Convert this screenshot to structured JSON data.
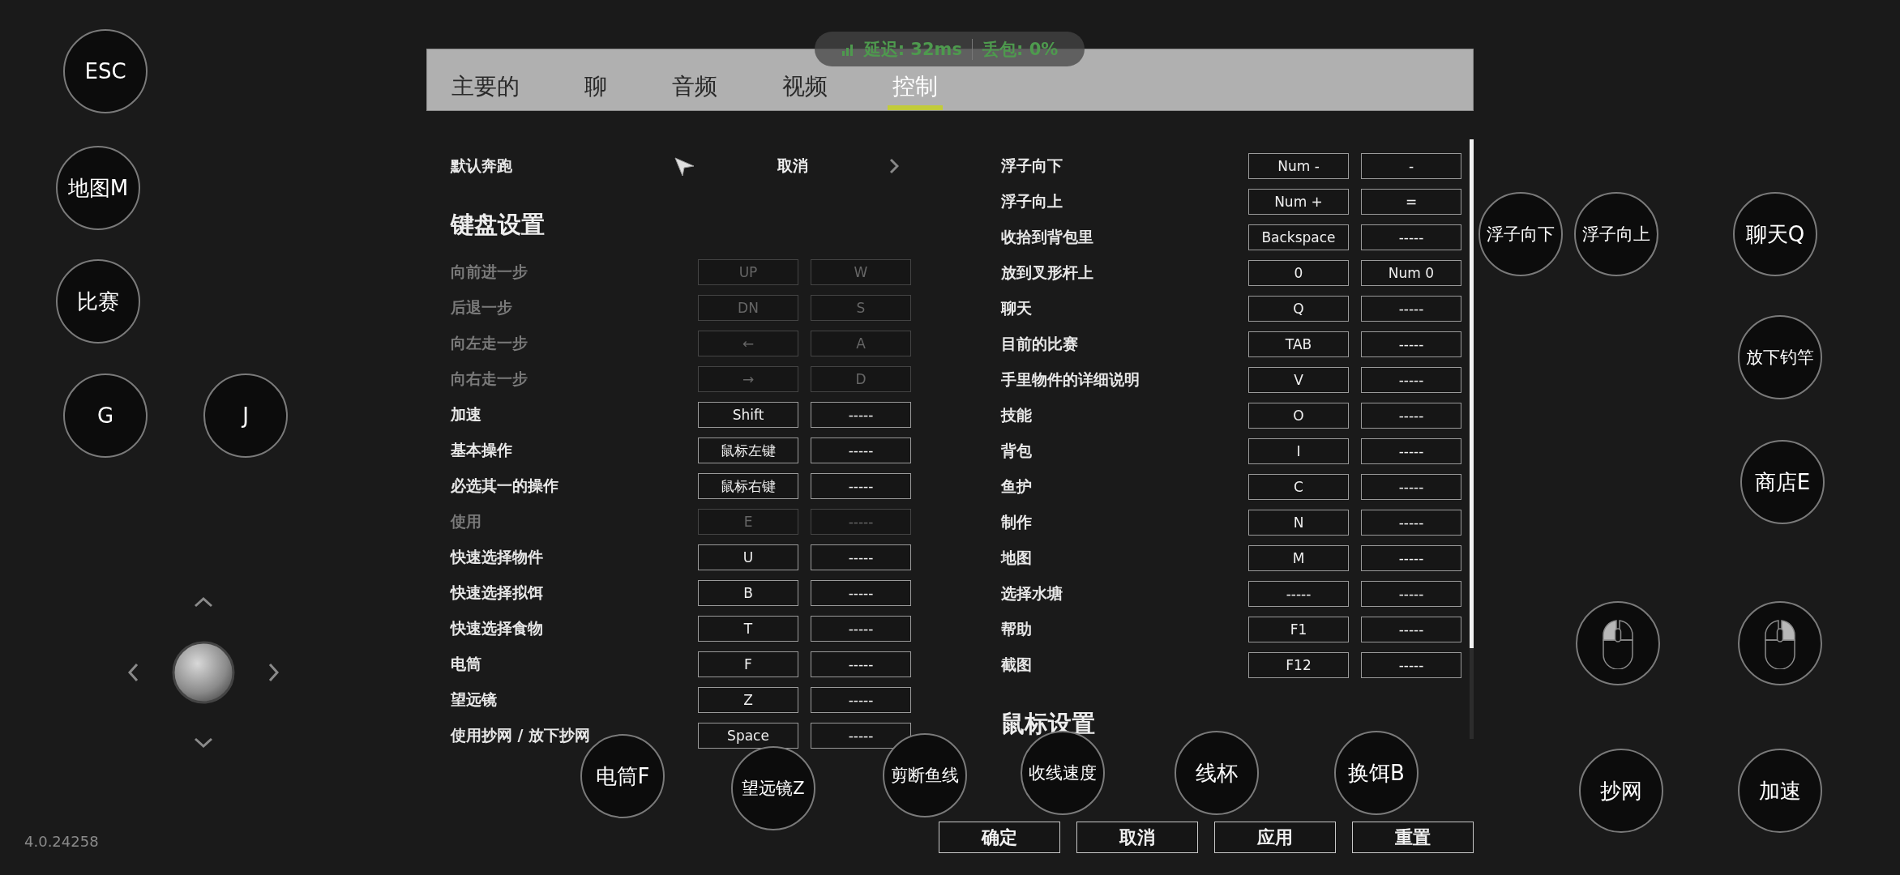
{
  "status": {
    "latency": "延迟: 32ms",
    "loss": "丢包: 0%"
  },
  "tabs": [
    {
      "label": "主要的",
      "selected": false
    },
    {
      "label": "聊",
      "selected": false
    },
    {
      "label": "音频",
      "selected": false
    },
    {
      "label": "视频",
      "selected": false
    },
    {
      "label": "控制",
      "selected": true
    }
  ],
  "default_run": {
    "label": "默认奔跑",
    "value": "取消"
  },
  "keyboard_heading": "键盘设置",
  "left_bindings": [
    {
      "action": "向前进一步",
      "primary": "UP",
      "secondary": "W",
      "disabled": true
    },
    {
      "action": "后退一步",
      "primary": "DN",
      "secondary": "S",
      "disabled": true
    },
    {
      "action": "向左走一步",
      "primary": "←",
      "secondary": "A",
      "disabled": true
    },
    {
      "action": "向右走一步",
      "primary": "→",
      "secondary": "D",
      "disabled": true
    },
    {
      "action": "加速",
      "primary": "Shift",
      "secondary": "-----",
      "disabled": false
    },
    {
      "action": "基本操作",
      "primary": "鼠标左键",
      "secondary": "-----",
      "disabled": false
    },
    {
      "action": "必选其一的操作",
      "primary": "鼠标右键",
      "secondary": "-----",
      "disabled": false
    },
    {
      "action": "使用",
      "primary": "E",
      "secondary": "-----",
      "disabled": true
    },
    {
      "action": "快速选择物件",
      "primary": "U",
      "secondary": "-----",
      "disabled": false
    },
    {
      "action": "快速选择拟饵",
      "primary": "B",
      "secondary": "-----",
      "disabled": false
    },
    {
      "action": "快速选择食物",
      "primary": "T",
      "secondary": "-----",
      "disabled": false
    },
    {
      "action": "电筒",
      "primary": "F",
      "secondary": "-----",
      "disabled": false
    },
    {
      "action": "望远镜",
      "primary": "Z",
      "secondary": "-----",
      "disabled": false
    },
    {
      "action": "使用抄网 / 放下抄网",
      "primary": "Space",
      "secondary": "-----",
      "disabled": false
    }
  ],
  "right_bindings": [
    {
      "action": "浮子向下",
      "primary": "Num -",
      "secondary": "-",
      "disabled": false
    },
    {
      "action": "浮子向上",
      "primary": "Num +",
      "secondary": "=",
      "disabled": false
    },
    {
      "action": "收拾到背包里",
      "primary": "Backspace",
      "secondary": "-----",
      "disabled": false
    },
    {
      "action": "放到叉形杆上",
      "primary": "0",
      "secondary": "Num 0",
      "disabled": false
    },
    {
      "action": "聊天",
      "primary": "Q",
      "secondary": "-----",
      "disabled": false
    },
    {
      "action": "目前的比赛",
      "primary": "TAB",
      "secondary": "-----",
      "disabled": false
    },
    {
      "action": "手里物件的详细说明",
      "primary": "V",
      "secondary": "-----",
      "disabled": false
    },
    {
      "action": "技能",
      "primary": "O",
      "secondary": "-----",
      "disabled": false
    },
    {
      "action": "背包",
      "primary": "I",
      "secondary": "-----",
      "disabled": false
    },
    {
      "action": "鱼护",
      "primary": "C",
      "secondary": "-----",
      "disabled": false
    },
    {
      "action": "制作",
      "primary": "N",
      "secondary": "-----",
      "disabled": false
    },
    {
      "action": "地图",
      "primary": "M",
      "secondary": "-----",
      "disabled": false
    },
    {
      "action": "选择水塘",
      "primary": "-----",
      "secondary": "-----",
      "disabled": false
    },
    {
      "action": "帮助",
      "primary": "F1",
      "secondary": "-----",
      "disabled": false
    },
    {
      "action": "截图",
      "primary": "F12",
      "secondary": "-----",
      "disabled": false
    }
  ],
  "mouse_heading": "鼠标设置",
  "buttons": [
    "确定",
    "取消",
    "应用",
    "重置"
  ],
  "overlay_buttons": [
    {
      "kind": "text",
      "label": "ESC"
    },
    {
      "kind": "text",
      "label": "地图M"
    },
    {
      "kind": "text",
      "label": "比赛"
    },
    {
      "kind": "text",
      "label": "G"
    },
    {
      "kind": "text",
      "label": "J"
    },
    {
      "kind": "text",
      "label": "电筒F"
    },
    {
      "kind": "text",
      "label": "望远镜Z"
    },
    {
      "kind": "text",
      "label": "剪断鱼线"
    },
    {
      "kind": "text",
      "label": "收线速度"
    },
    {
      "kind": "text",
      "label": "线杯"
    },
    {
      "kind": "text",
      "label": "换饵B"
    },
    {
      "kind": "text",
      "label": "浮子向下"
    },
    {
      "kind": "text",
      "label": "浮子向上"
    },
    {
      "kind": "text",
      "label": "聊天Q"
    },
    {
      "kind": "text",
      "label": "放下钓竿"
    },
    {
      "kind": "text",
      "label": "商店E"
    },
    {
      "kind": "leftclick"
    },
    {
      "kind": "rightclick"
    },
    {
      "kind": "text",
      "label": "抄网"
    },
    {
      "kind": "text",
      "label": "加速"
    }
  ],
  "version": "4.0.24258"
}
